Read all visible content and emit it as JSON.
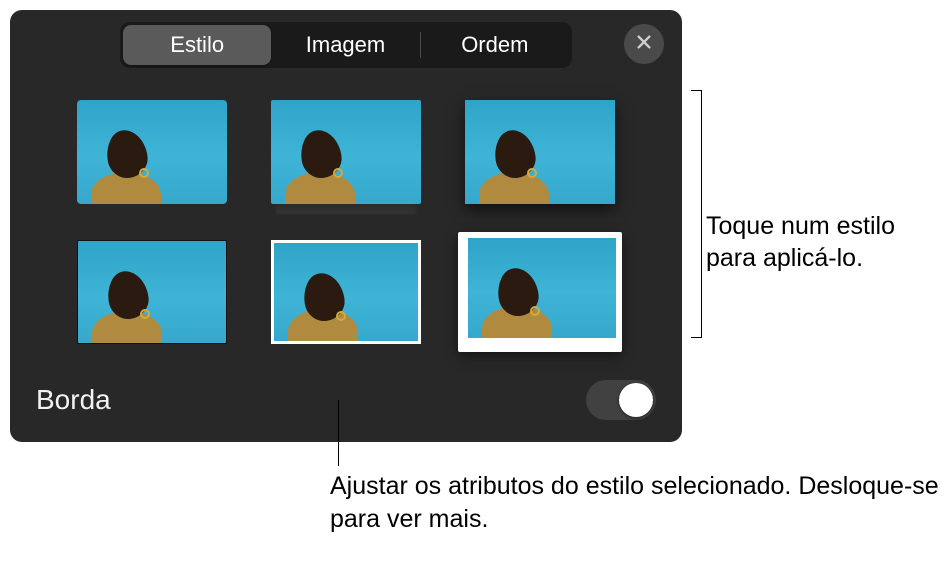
{
  "tabs": {
    "style": "Estilo",
    "image": "Imagem",
    "order": "Ordem"
  },
  "thumbnails": [
    {
      "name": "style-thumb-1"
    },
    {
      "name": "style-thumb-2"
    },
    {
      "name": "style-thumb-3"
    },
    {
      "name": "style-thumb-4"
    },
    {
      "name": "style-thumb-5"
    },
    {
      "name": "style-thumb-6"
    }
  ],
  "border": {
    "label": "Borda"
  },
  "callouts": {
    "right": "Toque num estilo para aplicá-lo.",
    "bottom": "Ajustar os atributos do estilo selecionado. Desloque-se para ver mais."
  },
  "icons": {
    "close": "close-icon"
  },
  "colors": {
    "panel_bg": "#282828",
    "tab_active_bg": "#5a5a5a"
  }
}
